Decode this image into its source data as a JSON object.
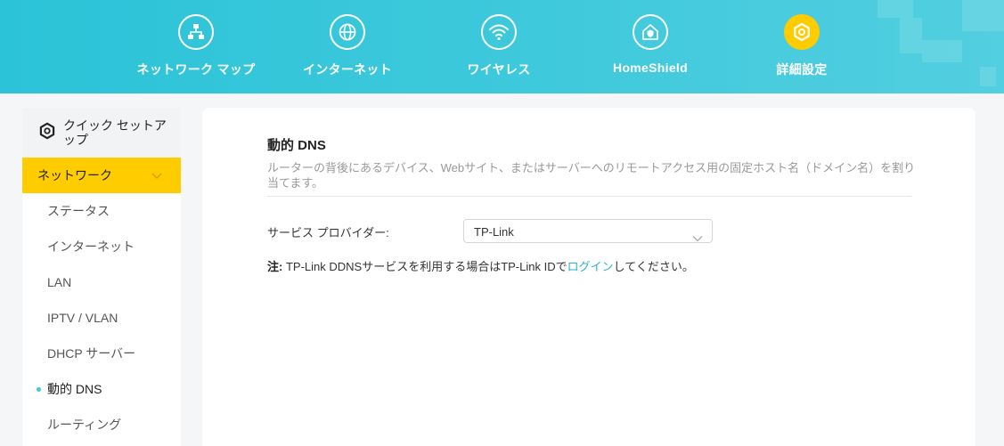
{
  "nav": {
    "items": [
      {
        "label": "ネットワーク マップ",
        "icon": "network-map-icon"
      },
      {
        "label": "インターネット",
        "icon": "globe-icon"
      },
      {
        "label": "ワイヤレス",
        "icon": "wifi-icon"
      },
      {
        "label": "HomeShield",
        "icon": "home-shield-icon"
      },
      {
        "label": "詳細設定",
        "icon": "advanced-gear-icon"
      }
    ],
    "active": "詳細設定"
  },
  "sidebar": {
    "quick_setup": "クイック セットアップ",
    "section": "ネットワーク",
    "items": [
      {
        "label": "ステータス"
      },
      {
        "label": "インターネット"
      },
      {
        "label": "LAN"
      },
      {
        "label": "IPTV / VLAN"
      },
      {
        "label": "DHCP サーバー"
      },
      {
        "label": "動的 DNS"
      },
      {
        "label": "ルーティング"
      }
    ],
    "active_item": "動的 DNS"
  },
  "main": {
    "title": "動的 DNS",
    "description": "ルーターの背後にあるデバイス、Webサイト、またはサーバーへのリモートアクセス用の固定ホスト名（ドメイン名）を割り当てます。",
    "provider_label": "サービス プロバイダー:",
    "provider_value": "TP-Link",
    "note_prefix": "注:",
    "note_text": " TP-Link DDNSサービスを利用する場合はTP-Link IDで",
    "note_link": "ログイン",
    "note_suffix": "してください。"
  },
  "colors": {
    "header": "#3fc9dc",
    "accent": "#ffcc00",
    "link": "#2bb3cb"
  }
}
